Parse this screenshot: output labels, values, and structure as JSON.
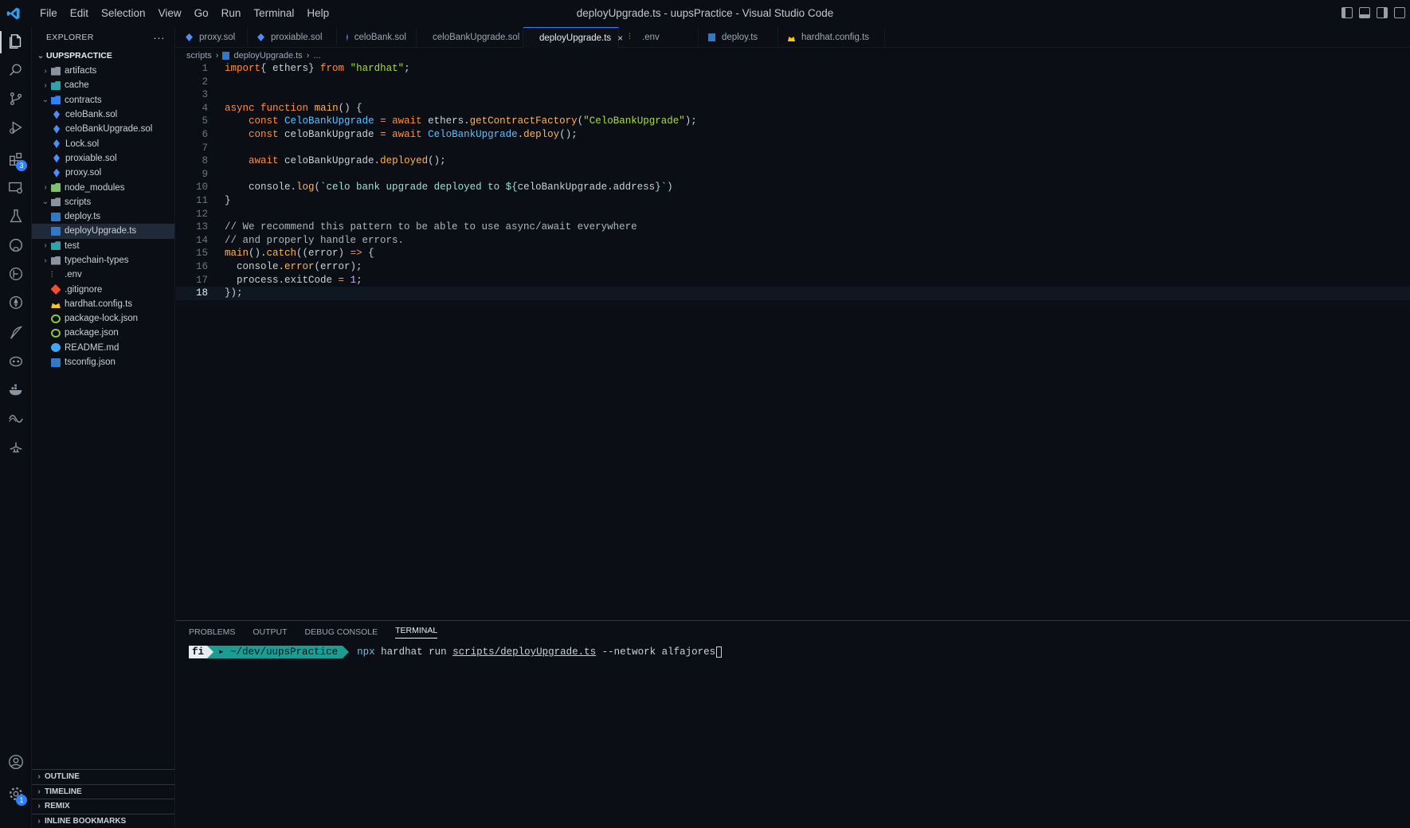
{
  "window": {
    "title": "deployUpgrade.ts - uupsPractice - Visual Studio Code",
    "menu": [
      "File",
      "Edit",
      "Selection",
      "View",
      "Go",
      "Run",
      "Terminal",
      "Help"
    ]
  },
  "activitybar": {
    "items": [
      {
        "icon": "files-icon",
        "active": true
      },
      {
        "icon": "search-icon"
      },
      {
        "icon": "source-control-icon"
      },
      {
        "icon": "run-debug-icon"
      },
      {
        "icon": "extensions-icon",
        "badge": "3"
      },
      {
        "icon": "remote-explorer-icon"
      },
      {
        "icon": "testing-icon"
      },
      {
        "icon": "github-icon"
      },
      {
        "icon": "git-graph-icon"
      },
      {
        "icon": "ethereum-icon"
      },
      {
        "icon": "quill-icon"
      },
      {
        "icon": "copilot-icon"
      },
      {
        "icon": "docker-icon"
      },
      {
        "icon": "remix-icon"
      },
      {
        "icon": "lamp-icon"
      }
    ],
    "bottom": [
      {
        "icon": "account-icon"
      },
      {
        "icon": "manage-gear-icon",
        "badge": "1"
      }
    ]
  },
  "explorer": {
    "header": "EXPLORER",
    "root": "UUPSPRACTICE",
    "items": [
      {
        "label": "artifacts",
        "type": "folder",
        "depth": 1,
        "state": "closed",
        "color": "gray"
      },
      {
        "label": "cache",
        "type": "folder",
        "depth": 1,
        "state": "closed",
        "color": "teal"
      },
      {
        "label": "contracts",
        "type": "folder",
        "depth": 1,
        "state": "open",
        "color": "blue"
      },
      {
        "label": "celoBank.sol",
        "type": "sol",
        "depth": 2
      },
      {
        "label": "celoBankUpgrade.sol",
        "type": "sol",
        "depth": 2
      },
      {
        "label": "Lock.sol",
        "type": "sol",
        "depth": 2
      },
      {
        "label": "proxiable.sol",
        "type": "sol",
        "depth": 2
      },
      {
        "label": "proxy.sol",
        "type": "sol",
        "depth": 2
      },
      {
        "label": "node_modules",
        "type": "folder",
        "depth": 1,
        "state": "closed",
        "color": "green"
      },
      {
        "label": "scripts",
        "type": "folder",
        "depth": 1,
        "state": "open",
        "color": "gray"
      },
      {
        "label": "deploy.ts",
        "type": "ts",
        "depth": 2
      },
      {
        "label": "deployUpgrade.ts",
        "type": "ts",
        "depth": 2,
        "selected": true
      },
      {
        "label": "test",
        "type": "folder",
        "depth": 1,
        "state": "closed",
        "color": "teal"
      },
      {
        "label": "typechain-types",
        "type": "folder",
        "depth": 1,
        "state": "closed",
        "color": "gray"
      },
      {
        "label": ".env",
        "type": "env",
        "depth": 1
      },
      {
        "label": ".gitignore",
        "type": "git",
        "depth": 1
      },
      {
        "label": "hardhat.config.ts",
        "type": "hardhat",
        "depth": 1
      },
      {
        "label": "package-lock.json",
        "type": "json",
        "depth": 1
      },
      {
        "label": "package.json",
        "type": "json",
        "depth": 1
      },
      {
        "label": "README.md",
        "type": "info",
        "depth": 1
      },
      {
        "label": "tsconfig.json",
        "type": "tsconfig",
        "depth": 1
      }
    ],
    "sections": [
      "OUTLINE",
      "TIMELINE",
      "REMIX",
      "INLINE BOOKMARKS"
    ]
  },
  "tabs": [
    {
      "label": "proxy.sol",
      "icon": "sol"
    },
    {
      "label": "proxiable.sol",
      "icon": "sol"
    },
    {
      "label": "celoBank.sol",
      "icon": "sol"
    },
    {
      "label": "celoBankUpgrade.sol",
      "icon": "sol"
    },
    {
      "label": "deployUpgrade.ts",
      "icon": "ts",
      "active": true,
      "close": "×"
    },
    {
      "label": ".env",
      "icon": "env"
    },
    {
      "label": "deploy.ts",
      "icon": "ts"
    },
    {
      "label": "hardhat.config.ts",
      "icon": "hardhat"
    }
  ],
  "breadcrumb": [
    "scripts",
    "deployUpgrade.ts",
    "..."
  ],
  "editor": {
    "current_line": 18,
    "lines": [
      [
        [
          "kw",
          "import"
        ],
        [
          "",
          "{ ethers} "
        ],
        [
          "kw",
          "from"
        ],
        [
          "",
          " "
        ],
        [
          "str",
          "\"hardhat\""
        ],
        [
          "",
          ";"
        ]
      ],
      [],
      [],
      [
        [
          "kw",
          "async"
        ],
        [
          "",
          " "
        ],
        [
          "kw",
          "function"
        ],
        [
          "",
          " "
        ],
        [
          "fn",
          "main"
        ],
        [
          "",
          "() {"
        ]
      ],
      [
        [
          "",
          "    "
        ],
        [
          "kw",
          "const"
        ],
        [
          "",
          " "
        ],
        [
          "var",
          "CeloBankUpgrade"
        ],
        [
          "",
          " "
        ],
        [
          "op",
          "="
        ],
        [
          "",
          " "
        ],
        [
          "kw",
          "await"
        ],
        [
          "",
          " ethers."
        ],
        [
          "fn",
          "getContractFactory"
        ],
        [
          "",
          "("
        ],
        [
          "str",
          "\"CeloBankUpgrade\""
        ],
        [
          "",
          ");"
        ]
      ],
      [
        [
          "",
          "    "
        ],
        [
          "kw",
          "const"
        ],
        [
          "",
          " celoBankUpgrade "
        ],
        [
          "op",
          "="
        ],
        [
          "",
          " "
        ],
        [
          "kw",
          "await"
        ],
        [
          "",
          " "
        ],
        [
          "var",
          "CeloBankUpgrade"
        ],
        [
          "",
          "."
        ],
        [
          "fn",
          "deploy"
        ],
        [
          "",
          "();"
        ]
      ],
      [],
      [
        [
          "",
          "    "
        ],
        [
          "kw",
          "await"
        ],
        [
          "",
          " celoBankUpgrade."
        ],
        [
          "fn",
          "deployed"
        ],
        [
          "",
          "();"
        ]
      ],
      [],
      [
        [
          "",
          "    console."
        ],
        [
          "fn",
          "log"
        ],
        [
          "",
          "("
        ],
        [
          "tpl",
          "`celo bank upgrade deployed to ${"
        ],
        [
          "",
          "celoBankUpgrade.address"
        ],
        [
          "tpl",
          "}`"
        ],
        [
          "",
          ")"
        ]
      ],
      [
        [
          "",
          "}"
        ]
      ],
      [],
      [
        [
          "cmt",
          "// We recommend this pattern to be able to use async/await everywhere"
        ]
      ],
      [
        [
          "cmt",
          "// and properly handle errors."
        ]
      ],
      [
        [
          "fn",
          "main"
        ],
        [
          "",
          "()."
        ],
        [
          "fn",
          "catch"
        ],
        [
          "",
          "((error) "
        ],
        [
          "op",
          "=>"
        ],
        [
          "",
          " {"
        ]
      ],
      [
        [
          "",
          "  console."
        ],
        [
          "fn",
          "error"
        ],
        [
          "",
          "(error);"
        ]
      ],
      [
        [
          "",
          "  process.exitCode "
        ],
        [
          "op",
          "="
        ],
        [
          "",
          " "
        ],
        [
          "num",
          "1"
        ],
        [
          "",
          ";"
        ]
      ],
      [
        [
          "",
          "});"
        ]
      ]
    ]
  },
  "panel": {
    "tabs": [
      "PROBLEMS",
      "OUTPUT",
      "DEBUG CONSOLE",
      "TERMINAL"
    ],
    "active_tab": "TERMINAL",
    "terminal": {
      "prompt_icon": "fi",
      "cwd": "~/dev/uupsPractice",
      "cmd_npx": "npx",
      "cmd_mid": " hardhat run ",
      "cmd_path": "scripts/deployUpgrade.ts",
      "cmd_tail": " --network alfajores"
    }
  }
}
